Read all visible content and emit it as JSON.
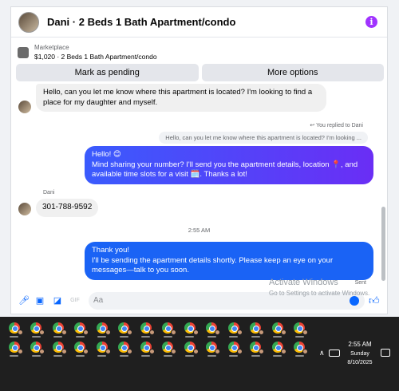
{
  "chat": {
    "title": "Dani · 2 Beds 1 Bath Apartment/condo",
    "listing": {
      "source": "Marketplace",
      "price_title": "$1,020 · 2 Beds 1 Bath Apartment/condo"
    },
    "actions": {
      "mark_pending": "Mark as pending",
      "more_options": "More options"
    },
    "messages": {
      "incoming_1": "Hello, can you let me know where this apartment is located? I'm looking to find a place for my daughter and myself.",
      "replied_label": "You replied to Dani",
      "quote": "Hello, can you let me know where this apartment is located? I'm looking ...",
      "outgoing_1_line1": "Hello! 😊",
      "outgoing_1_line2": "Mind sharing your number? I'll send you the apartment details, location 📍, and available time slots for a visit 🗓️. Thanks a lot!",
      "sender_name": "Dani",
      "incoming_2": "301-788-9592",
      "timestamp": "2:55 AM",
      "outgoing_2_line1": "Thank you!",
      "outgoing_2_line2": "I'll be sending the apartment details shortly. Please keep an eye on your messages—talk to you soon.",
      "status": "Sent"
    },
    "composer": {
      "placeholder": "Aa"
    }
  },
  "watermark": {
    "line1": "Activate Windows",
    "line2": "Go to Settings to activate Windows."
  },
  "taskbar": {
    "icon": "chrome-icon",
    "time": "2:55 AM",
    "day": "Sunday",
    "date": "8/10/2025"
  },
  "colors": {
    "accent": "#0866ff",
    "bubble_gradient_start": "#3a5bfd",
    "bubble_gradient_end": "#6a2ef5",
    "info_icon": "#a033ff"
  }
}
